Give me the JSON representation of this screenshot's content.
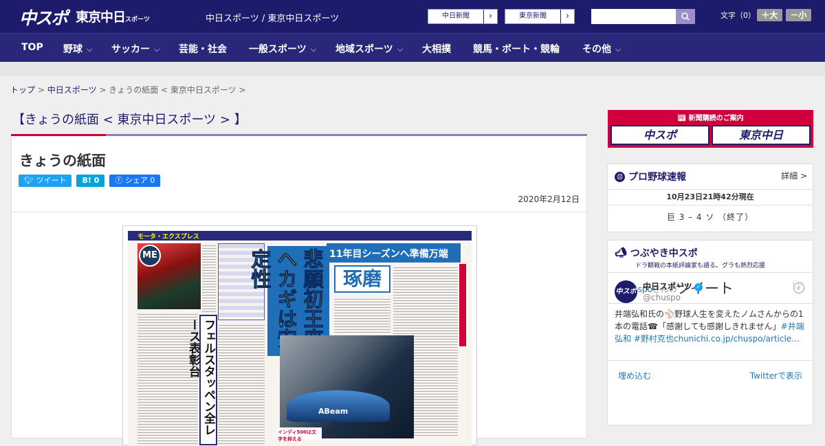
{
  "header": {
    "logo_chuspo": "中スポ",
    "logo_tokyo": "東京中日",
    "logo_tokyo_small": "スポーツ",
    "site_name": "中日スポーツ / 東京中日スポーツ",
    "link_chunichi": "中日新聞",
    "link_tokyo": "東京新聞",
    "link_arrow": "›",
    "search_placeholder": "",
    "font_size_label": "文字（0）",
    "font_bigger": "＋大",
    "font_smaller": "－小"
  },
  "nav": [
    {
      "label": "TOP",
      "chev": ""
    },
    {
      "label": "野球",
      "chev": "⌵"
    },
    {
      "label": "サッカー",
      "chev": "⌵"
    },
    {
      "label": "芸能・社会",
      "chev": ""
    },
    {
      "label": "一般スポーツ",
      "chev": "⌵"
    },
    {
      "label": "地域スポーツ",
      "chev": "⌵"
    },
    {
      "label": "大相撲",
      "chev": ""
    },
    {
      "label": "競馬・ボート・競輪",
      "chev": ""
    },
    {
      "label": "その他",
      "chev": "⌵"
    }
  ],
  "breadcrumb": {
    "top": "トップ",
    "sep": ">",
    "chunichi": "中日スポーツ",
    "current": "きょうの紙面 < 東京中日スポーツ >"
  },
  "page_title": "【きょうの紙面 < 東京中日スポーツ > 】",
  "article": {
    "heading": "きょうの紙面",
    "tweet_btn": "ツイート",
    "hatena_btn": "B! 0",
    "facebook_btn": "シェア 0",
    "date": "2020年2月12日"
  },
  "newspaper": {
    "section": "モータ・エクスプレス",
    "badge": "ME",
    "vertical_caption": "フェルスタッペン全レース表彰台",
    "headline_big": "悲願初王座へカギは安定性",
    "headline_top": "11年目シーズンへ準備万端",
    "headline_name": "琢磨",
    "car_label": "ABeam",
    "caption": "インディ500は文字を抑える"
  },
  "sidebar": {
    "ad_title": "新聞購読のご案内",
    "ad_chuspo": "中スポ",
    "ad_tokyo": "東京中日",
    "baseball": {
      "title": "プロ野球速報",
      "detail": "詳細 >",
      "stamp": "10月23日21時42分現在",
      "score": "巨 3 – 4 ソ （終了）"
    },
    "twitter": {
      "title": "つぶやき中スポ",
      "subtitle": "ドラ観戦の本紙評論家も語る。グラも熱烈応援",
      "handle_prefix": "@chuspo",
      "handle_suffix": "さんの",
      "tweets_word": "ツイート",
      "user_name": "中日スポーツ",
      "user_handle": "@chuspo",
      "tweet_text": "井端弘和氏の⚾野球人生を変えたノムさんからの1本の電話☎「感謝しても感謝しきれません」",
      "tweet_links": "#井端弘和 #野村克也chunichi.co.jp/chuspo/article…",
      "embed": "埋め込む",
      "view_on_twitter": "Twitterで表示"
    }
  },
  "colors": {
    "brand_navy": "#1d1c6c",
    "accent_red": "#d1003d",
    "link_blue": "#1d78b5"
  }
}
